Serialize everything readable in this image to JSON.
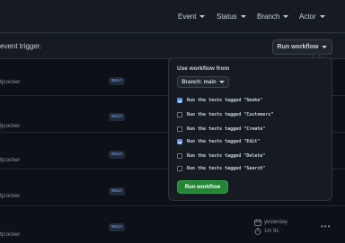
{
  "filters": {
    "event": "Event",
    "status": "Status",
    "branch": "Branch",
    "actor": "Actor"
  },
  "trigger_banner": {
    "text": "event trigger.",
    "run_workflow_button": "Run workflow"
  },
  "runs": [
    {
      "actor": "tjcocker",
      "branch": "main"
    },
    {
      "actor": "tjcocker",
      "branch": "main"
    },
    {
      "actor": "tjcocker",
      "branch": "main"
    },
    {
      "actor": "tjcocker",
      "branch": "main"
    },
    {
      "actor": "tjcocker",
      "branch": "main",
      "date": "yesterday",
      "duration": "1m 9s"
    }
  ],
  "workflow_popup": {
    "title": "Use workflow from",
    "branch_select": "Branch: main",
    "options": [
      {
        "label": "Run the tests tagged \"Smoke\"",
        "checked": true
      },
      {
        "label": "Run the tests tagged \"Customers\"",
        "checked": false
      },
      {
        "label": "Run the tests tagged \"Create\"",
        "checked": false
      },
      {
        "label": "Run the tests tagged \"Edit\"",
        "checked": true
      },
      {
        "label": "Run the tests tagged \"Delete\"",
        "checked": false
      },
      {
        "label": "Run the tests tagged \"Search\"",
        "checked": false
      }
    ],
    "submit_button": "Run workflow"
  },
  "colors": {
    "background": "#0d1117",
    "panel": "#161b22",
    "accent_blue": "#4f8cf0",
    "run_green": "#238636"
  }
}
